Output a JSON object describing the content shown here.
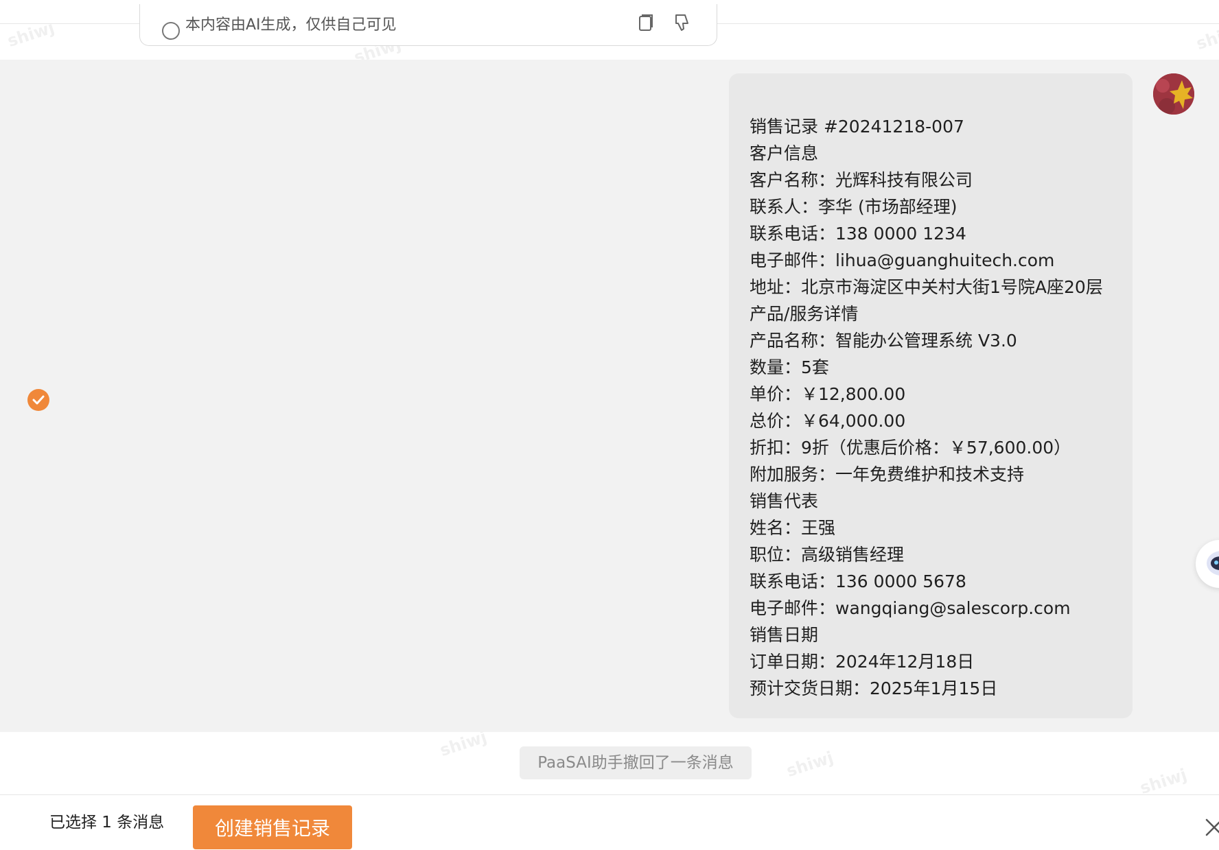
{
  "previous_message": {
    "notice_text": "本内容由AI生成，仅供自己可见",
    "icons": [
      "info-circle-icon",
      "copy-icon",
      "thumbs-down-icon"
    ]
  },
  "message": {
    "lines": [
      "销售记录 #20241218-007",
      "客户信息",
      "客户名称：光辉科技有限公司",
      "联系人：李华 (市场部经理)",
      "联系电话：138 0000 1234",
      "电子邮件：lihua@guanghuitech.com",
      "地址：北京市海淀区中关村大街1号院A座20层",
      "产品/服务详情",
      "产品名称：智能办公管理系统 V3.0",
      "数量：5套",
      "单价：￥12,800.00",
      "总价：￥64,000.00",
      "折扣：9折（优惠后价格：￥57,600.00）",
      "附加服务：一年免费维护和技术支持",
      "销售代表",
      "姓名：王强",
      "职位：高级销售经理",
      "联系电话：136 0000 5678",
      "电子邮件：wangqiang@salescorp.com",
      "销售日期",
      "订单日期：2024年12月18日",
      "预计交货日期：2025年1月15日"
    ],
    "selected": true
  },
  "system_notice": "PaaSAI助手撤回了一条消息",
  "footer": {
    "selected_text": "已选择 1 条消息",
    "create_button": "创建销售记录"
  },
  "watermark": "shiwj",
  "colors": {
    "accent": "#f0883a",
    "message_row_bg": "#f2f2f2",
    "bubble_bg": "#e8e8e8"
  }
}
